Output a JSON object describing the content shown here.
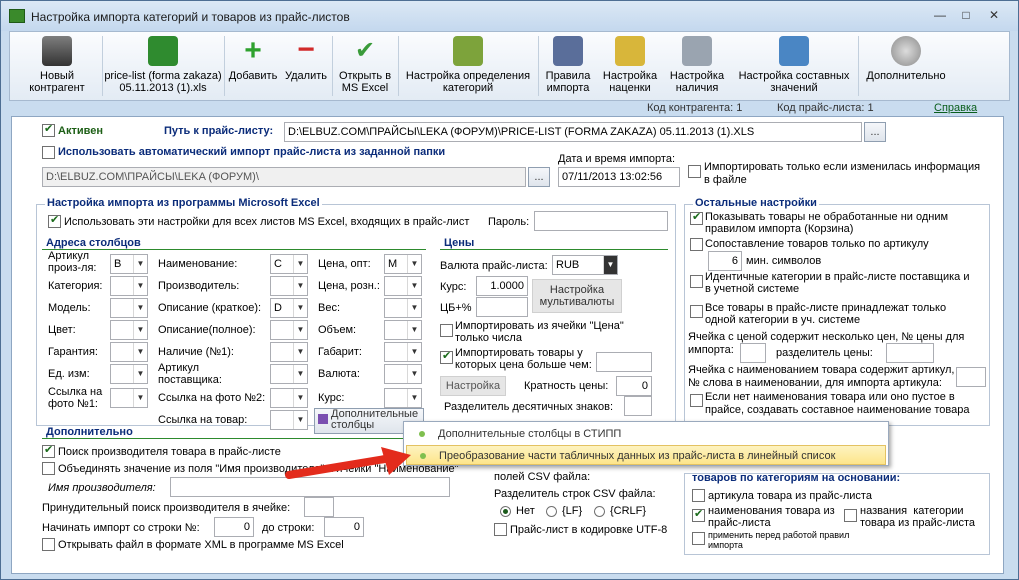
{
  "window": {
    "title": "Настройка импорта категорий и товаров из прайс-листов"
  },
  "toolbar": {
    "new_contractor": "Новый\nконтрагент",
    "pricelist_file": "price-list (forma zakaza)\n05.11.2013 (1).xls",
    "add": "Добавить",
    "delete": "Удалить",
    "open_excel": "Открыть в\nMS Excel",
    "category_detect": "Настройка определения\nкатегорий",
    "import_rules": "Правила\nимпорта",
    "markup_settings": "Настройка\nнаценки",
    "stock_settings": "Настройка\nналичия",
    "composite_values": "Настройка составных\nзначений",
    "more": "Дополнительно"
  },
  "status": {
    "contractor_code": "Код контрагента: 1",
    "pricelist_code": "Код прайс-листа: 1",
    "help": "Справка"
  },
  "top": {
    "active_label": "Активен",
    "path_label": "Путь к прайс-листу:",
    "path_value": "D:\\ELBUZ.COM\\ПРАЙСЫ\\LEKA (ФОРУМ)\\PRICE-LIST (FORMA ZAKAZA) 05.11.2013 (1).XLS",
    "browse": "...",
    "auto_import_label": "Использовать автоматический импорт прайс-листа из заданной папки",
    "auto_folder": "D:\\ELBUZ.COM\\ПРАЙСЫ\\LEKA (ФОРУМ)\\",
    "datetime_label": "Дата и время импорта:",
    "datetime_value": "07/11/2013 13:02:56",
    "only_changed": "Импортировать только если изменилась информация\nв файле"
  },
  "excel": {
    "legend": "Настройка импорта из программы Microsoft Excel",
    "use_for_all": "Использовать эти настройки для всех листов MS Excel, входящих в прайс-лист",
    "password_label": "Пароль:",
    "columns_title": "Адреса столбцов",
    "prices_title": "Цены",
    "col": {
      "article": "Артикул\nпроиз-ля:",
      "article_val": "B",
      "category": "Категория:",
      "model": "Модель:",
      "color": "Цвет:",
      "warranty": "Гарантия:",
      "unit": "Ед. изм:",
      "photo1": "Ссылка на\nфото №1:",
      "name": "Наименование:",
      "name_val": "C",
      "maker": "Производитель:",
      "desc_short": "Описание (краткое):",
      "desc_short_val": "D",
      "desc_full": "Описание(полное):",
      "stock1": "Наличие (№1):",
      "supplier_article": "Артикул\nпоставщика:",
      "photo2": "Ссылка на фото №2:",
      "product_link": "Ссылка на товар:",
      "price_opt": "Цена, опт:",
      "price_opt_val": "M",
      "price_retail": "Цена, розн.:",
      "weight": "Вес:",
      "volume": "Объем:",
      "size": "Габарит:",
      "currency": "Валюта:",
      "rate": "Курс:",
      "extra_cols": "Дополнительные\nстолбцы"
    },
    "prices": {
      "currency_label": "Валюта прайс-листа:",
      "currency_val": "RUB",
      "rate_label": "Курс:",
      "rate_val": "1.0000",
      "cb_label": "ЦБ+%",
      "multi_btn": "Настройка\nмультивалюты",
      "import_from_price_cell": "Импортировать из ячейки \"Цена\"\nтолько числа",
      "import_gt": "Импортировать товары у\nкоторых цена больше чем:",
      "conversion_btn": "Настройка",
      "multiplicity_label": "Кратность цены:",
      "multiplicity_val": "0",
      "decimal_sep_label": "Разделитель десятичных знаков:"
    }
  },
  "extra": {
    "title": "Дополнительно",
    "search_maker": "Поиск производителя товара в прайс-листе",
    "merge_values": "Объединять значение из поля \"Имя производителя\" и ячейки \"Наименование\"",
    "maker_name_label": "Имя производителя:",
    "force_maker_label": "Принудительный поиск производителя в ячейке:",
    "start_row_label": "Начинать импорт со строки №:",
    "start_row_val": "0",
    "to_row_label": "до строки:",
    "to_row_val": "0",
    "open_xml": "Открывать файл в формате XML в программе MS Excel"
  },
  "csv": {
    "fields_sep_label": "полей CSV файла:",
    "rows_sep_label": "Разделитель строк CSV файла:",
    "opt_none": "Нет",
    "opt_lf": "{LF}",
    "opt_crlf": "{CRLF}",
    "utf8": "Прайс-лист в кодировке UTF-8"
  },
  "other": {
    "legend": "Остальные настройки",
    "show_unprocessed": "Показывать товары не обработанные ни одним\nправилом импорта (Корзина)",
    "match_by_article": "Сопоставление товаров только по артикулу",
    "min_symbols_val": "6",
    "min_symbols_label": "мин. символов",
    "identical_categories": "Идентичные категории в прайс-листе поставщика и\nв учетной системе",
    "all_in_one_category": "Все товары в прайс-листе принадлежат только\nодной категории в уч. системе",
    "multi_price_cell": "Ячейка с ценой содержит несколько цен, № цены для\nимпорта:",
    "price_separator_label": "разделитель цены:",
    "article_in_name": "Ячейка с наименованием товара содержит артикул,\n№ слова в наименовании, для импорта артикула:",
    "empty_name": "Если нет наименования товара или оно пустое в\nпрайсе, создавать составное наименование товара"
  },
  "bycat": {
    "legend": "товаров по категориям на основании:",
    "by_article": "артикула товара из прайс-листа",
    "by_name": "наименования товара из\nпрайс-листа",
    "by_category_names": "названия  категории\nтовара из прайс-листа",
    "apply_before": "применить перед работой правил\nимпорта"
  },
  "popup": {
    "item1": "Дополнительные столбцы в СТИПП",
    "item2": "Преобразование части табличных данных из прайс-листа в линейный список"
  },
  "colors": {
    "accent_green": "#1d5f16",
    "legend_blue": "#0b2c7a",
    "highlight": "#fde58a",
    "arrow": "#e32b1c"
  }
}
